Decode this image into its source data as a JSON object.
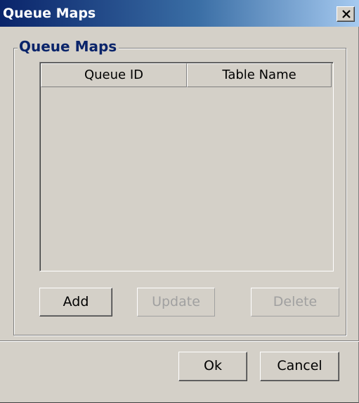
{
  "window": {
    "title": "Queue Maps"
  },
  "group": {
    "legend": "Queue Maps"
  },
  "table": {
    "columns": [
      "Queue ID",
      "Table Name"
    ],
    "rows": []
  },
  "buttons": {
    "add_label": "Add",
    "update_label": "Update",
    "delete_label": "Delete",
    "ok_label": "Ok",
    "cancel_label": "Cancel",
    "update_enabled": false,
    "delete_enabled": false
  },
  "icons": {
    "close": "close-icon"
  },
  "colors": {
    "title_gradient_start": "#0a246a",
    "title_gradient_end": "#a6caf0",
    "legend_text": "#0a246a",
    "dialog_background": "#d4d0c8"
  }
}
